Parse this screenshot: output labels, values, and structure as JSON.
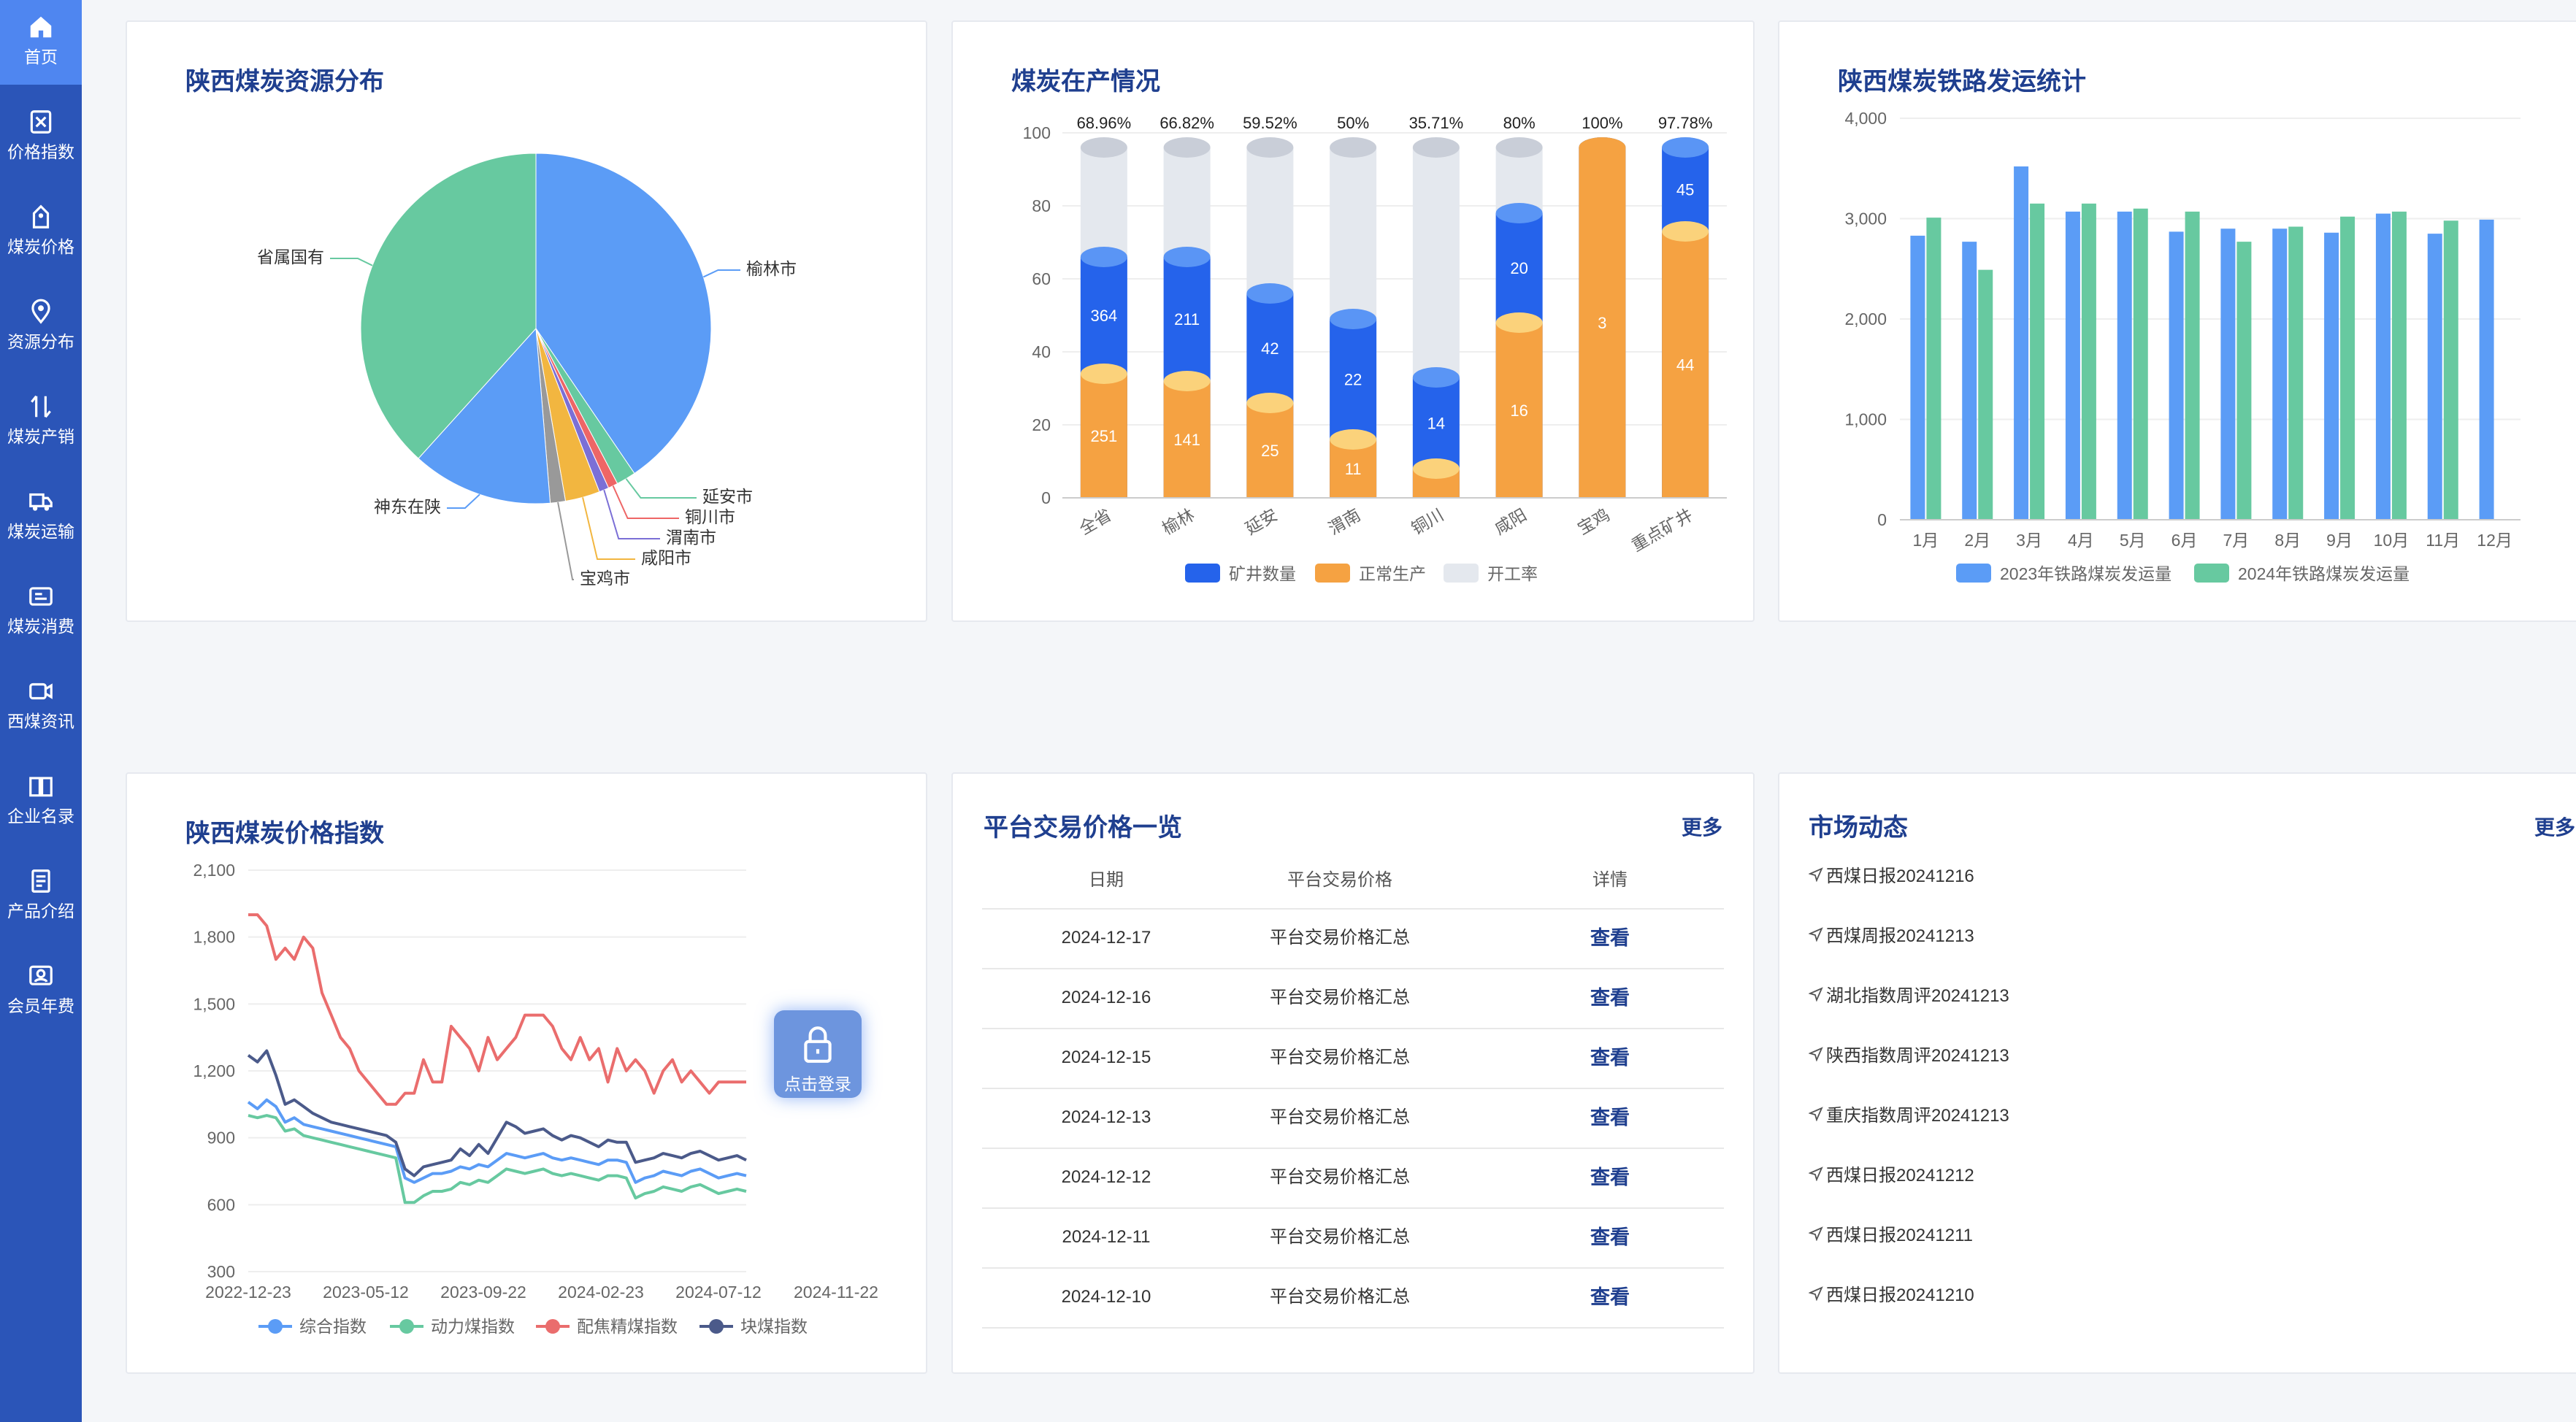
{
  "sidebar": {
    "items": [
      {
        "label": "首页",
        "icon": "home-icon",
        "active": true
      },
      {
        "label": "价格指数",
        "icon": "excel-icon"
      },
      {
        "label": "煤炭价格",
        "icon": "tag-icon"
      },
      {
        "label": "资源分布",
        "icon": "location-icon"
      },
      {
        "label": "煤炭产销",
        "icon": "transfer-icon"
      },
      {
        "label": "煤炭运输",
        "icon": "truck-icon"
      },
      {
        "label": "煤炭消费",
        "icon": "card-icon"
      },
      {
        "label": "西煤资讯",
        "icon": "video-icon"
      },
      {
        "label": "企业名录",
        "icon": "book-icon"
      },
      {
        "label": "产品介绍",
        "icon": "document-icon"
      },
      {
        "label": "会员年费",
        "icon": "member-icon"
      }
    ]
  },
  "resource": {
    "title": "陕西煤炭资源分布",
    "chart_data": {
      "type": "pie",
      "slices": [
        {
          "label": "榆林市",
          "value": 40.5,
          "color": "#5b9cf6"
        },
        {
          "label": "延安市",
          "value": 1.8,
          "color": "#67c9a0"
        },
        {
          "label": "铜川市",
          "value": 0.9,
          "color": "#ee6666"
        },
        {
          "label": "渭南市",
          "value": 0.9,
          "color": "#7b6fd6"
        },
        {
          "label": "咸阳市",
          "value": 3.2,
          "color": "#f2b640"
        },
        {
          "label": "宝鸡市",
          "value": 1.4,
          "color": "#999999"
        },
        {
          "label": "神东在陕",
          "value": 13.0,
          "color": "#5b9cf6"
        },
        {
          "label": "省属国有",
          "value": 38.3,
          "color": "#67c9a0"
        }
      ]
    }
  },
  "production": {
    "title": "煤炭在产情况",
    "chart_data": {
      "type": "bar",
      "categories": [
        "全省",
        "榆林",
        "延安",
        "渭南",
        "铜川",
        "咸阳",
        "宝鸡",
        "重点矿井"
      ],
      "ylim": [
        0,
        100
      ],
      "yticks": [
        "0",
        "20",
        "40",
        "60",
        "80",
        "100"
      ],
      "series": [
        {
          "name": "矿井数量",
          "values": [
            364,
            211,
            42,
            22,
            14,
            20,
            3,
            45
          ],
          "heights": [
            66,
            66,
            56,
            49,
            33,
            78,
            96,
            96
          ],
          "color": "#2563eb"
        },
        {
          "name": "正常生产",
          "values": [
            251,
            141,
            25,
            11,
            8,
            16,
            3,
            44
          ],
          "heights": [
            34,
            32,
            26,
            16,
            8,
            48,
            96,
            73
          ],
          "color": "#f5a242"
        },
        {
          "name": "开工率",
          "values": [
            "68.96%",
            "66.82%",
            "59.52%",
            "50%",
            "35.71%",
            "80%",
            "100%",
            "97.78%"
          ],
          "color": "#e4e8ee"
        }
      ],
      "orange_label_hidden": [
        false,
        false,
        false,
        false,
        true,
        false,
        false,
        false
      ],
      "blue_label_hidden": [
        false,
        false,
        false,
        false,
        false,
        false,
        true,
        false
      ]
    }
  },
  "railway": {
    "title": "陕西煤炭铁路发运统计",
    "chart_data": {
      "type": "bar",
      "categories": [
        "1月",
        "2月",
        "3月",
        "4月",
        "5月",
        "6月",
        "7月",
        "8月",
        "9月",
        "10月",
        "11月",
        "12月"
      ],
      "ylim": [
        0,
        4000
      ],
      "yticks": [
        "0",
        "1,000",
        "2,000",
        "3,000",
        "4,000"
      ],
      "series": [
        {
          "name": "2023年铁路煤炭发运量",
          "values": [
            2830,
            2770,
            3520,
            3070,
            3070,
            2870,
            2900,
            2900,
            2860,
            3050,
            2850,
            2990
          ],
          "color": "#5b9cf6"
        },
        {
          "name": "2024年铁路煤炭发运量",
          "values": [
            3010,
            2490,
            3150,
            3150,
            3100,
            3070,
            2770,
            2920,
            3020,
            3070,
            2980,
            null
          ],
          "color": "#67c9a0"
        }
      ]
    }
  },
  "price_index": {
    "title": "陕西煤炭价格指数",
    "chart_data": {
      "type": "line",
      "x_start": "2022-12-23",
      "x_end": "2024-11-22",
      "xticks": [
        "2022-12-23",
        "2023-05-12",
        "2023-09-22",
        "2024-02-23",
        "2024-07-12",
        "2024-11-22"
      ],
      "ylim": [
        300,
        2100
      ],
      "yticks": [
        "300",
        "600",
        "900",
        "1,200",
        "1,500",
        "1,800",
        "2,100"
      ],
      "series": [
        {
          "name": "综合指数",
          "color": "#5b9cf6",
          "values": [
            1060,
            1030,
            1070,
            1040,
            970,
            990,
            960,
            950,
            940,
            930,
            920,
            910,
            900,
            890,
            880,
            870,
            860,
            720,
            700,
            720,
            740,
            740,
            750,
            770,
            760,
            780,
            770,
            800,
            830,
            820,
            810,
            820,
            830,
            810,
            800,
            810,
            800,
            790,
            780,
            800,
            800,
            790,
            700,
            720,
            730,
            750,
            740,
            730,
            750,
            760,
            740,
            720,
            730,
            740,
            730
          ]
        },
        {
          "name": "动力煤指数",
          "color": "#67c9a0",
          "values": [
            1000,
            990,
            1000,
            990,
            930,
            940,
            910,
            900,
            890,
            880,
            870,
            860,
            850,
            840,
            830,
            820,
            810,
            610,
            610,
            640,
            660,
            660,
            670,
            700,
            690,
            710,
            700,
            730,
            760,
            750,
            740,
            750,
            760,
            740,
            730,
            740,
            730,
            720,
            710,
            730,
            730,
            720,
            630,
            650,
            660,
            680,
            670,
            660,
            680,
            690,
            670,
            650,
            660,
            670,
            660
          ]
        },
        {
          "name": "配焦精煤指数",
          "color": "#ea6d6d",
          "values": [
            1900,
            1900,
            1850,
            1700,
            1750,
            1700,
            1800,
            1750,
            1550,
            1450,
            1350,
            1300,
            1200,
            1150,
            1100,
            1050,
            1050,
            1100,
            1100,
            1250,
            1150,
            1150,
            1400,
            1350,
            1300,
            1200,
            1350,
            1250,
            1300,
            1350,
            1450,
            1450,
            1450,
            1400,
            1300,
            1250,
            1350,
            1250,
            1300,
            1150,
            1300,
            1200,
            1250,
            1200,
            1100,
            1200,
            1250,
            1150,
            1200,
            1150,
            1100,
            1150,
            1150,
            1150,
            1150
          ]
        },
        {
          "name": "块煤指数",
          "color": "#4b5a8a",
          "values": [
            1270,
            1240,
            1290,
            1180,
            1050,
            1070,
            1040,
            1010,
            990,
            970,
            960,
            950,
            940,
            930,
            920,
            910,
            880,
            760,
            730,
            770,
            780,
            790,
            800,
            850,
            820,
            870,
            830,
            900,
            970,
            950,
            920,
            930,
            940,
            910,
            890,
            910,
            900,
            880,
            860,
            890,
            880,
            880,
            790,
            800,
            810,
            830,
            820,
            810,
            830,
            840,
            820,
            800,
            810,
            820,
            800
          ]
        }
      ]
    },
    "login_label": "点击登录"
  },
  "platform": {
    "title": "平台交易价格一览",
    "more": "更多",
    "columns": [
      "日期",
      "平台交易价格",
      "详情"
    ],
    "rows": [
      {
        "date": "2024-12-17",
        "name": "平台交易价格汇总",
        "action": "查看"
      },
      {
        "date": "2024-12-16",
        "name": "平台交易价格汇总",
        "action": "查看"
      },
      {
        "date": "2024-12-15",
        "name": "平台交易价格汇总",
        "action": "查看"
      },
      {
        "date": "2024-12-13",
        "name": "平台交易价格汇总",
        "action": "查看"
      },
      {
        "date": "2024-12-12",
        "name": "平台交易价格汇总",
        "action": "查看"
      },
      {
        "date": "2024-12-11",
        "name": "平台交易价格汇总",
        "action": "查看"
      },
      {
        "date": "2024-12-10",
        "name": "平台交易价格汇总",
        "action": "查看"
      }
    ]
  },
  "market": {
    "title": "市场动态",
    "more": "更多",
    "items": [
      {
        "title": "西煤日报20241216",
        "date": "2024-12-16"
      },
      {
        "title": "西煤周报20241213",
        "date": "2024-12-13"
      },
      {
        "title": "湖北指数周评20241213",
        "date": "2024-12-13"
      },
      {
        "title": "陕西指数周评20241213",
        "date": "2024-12-13"
      },
      {
        "title": "重庆指数周评20241213",
        "date": "2024-12-13"
      },
      {
        "title": "西煤日报20241212",
        "date": "2024-12-12"
      },
      {
        "title": "西煤日报20241211",
        "date": "2024-12-11"
      },
      {
        "title": "西煤日报20241210",
        "date": "2024-12-10"
      }
    ]
  }
}
